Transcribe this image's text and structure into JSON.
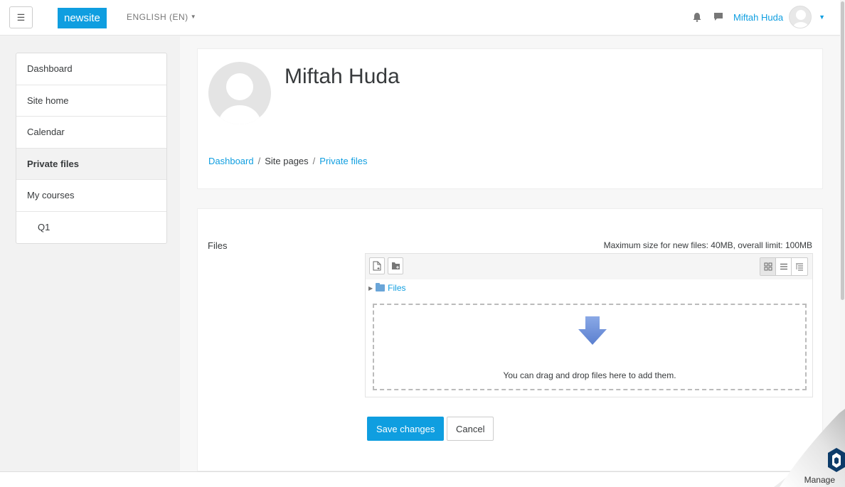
{
  "navbar": {
    "menu_glyph": "☰",
    "brand": "newsite",
    "language": "ENGLISH (EN)",
    "username": "Miftah Huda",
    "icons": [
      "bell-icon",
      "message-icon",
      "avatar",
      "chevron-down-icon"
    ]
  },
  "sidebar": {
    "items": [
      {
        "label": "Dashboard"
      },
      {
        "label": "Site home"
      },
      {
        "label": "Calendar"
      },
      {
        "label": "Private files"
      },
      {
        "label": "My courses"
      },
      {
        "label": "Q1"
      }
    ],
    "active": "Private files"
  },
  "header": {
    "title": "Miftah Huda",
    "breadcrumb": [
      "Dashboard",
      "Site pages",
      "Private files"
    ]
  },
  "form": {
    "files_label": "Files",
    "max_size": "Maximum size for new files: 40MB, overall limit: 100MB",
    "folder_path": "Files",
    "dropzone_text": "You can drag and drop files here to add them.",
    "save_label": "Save changes",
    "cancel_label": "Cancel"
  },
  "manage": {
    "label": "Manage"
  },
  "colors": {
    "accent": "#0f9ee0",
    "drop_arrow": "#6a8fd8"
  }
}
